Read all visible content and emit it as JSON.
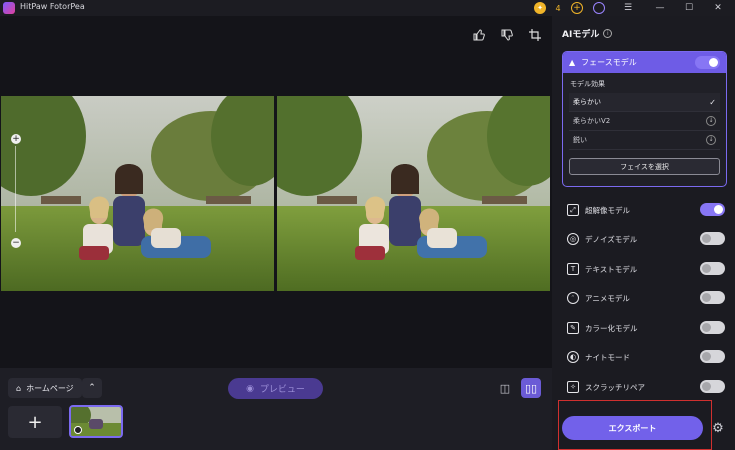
{
  "app": {
    "title": "HitPaw FotorPea",
    "coin_count": "4"
  },
  "titlebar": {
    "icons": [
      "coin-icon",
      "add-coin-icon",
      "account-icon",
      "menu-icon",
      "minimize-icon",
      "maximize-icon",
      "close-icon"
    ]
  },
  "workspace": {
    "toolbar": [
      "thumbs-up-icon",
      "thumbs-down-icon",
      "crop-icon"
    ]
  },
  "bottom": {
    "home_label": "ホームページ",
    "preview_label": "プレビュー",
    "add_label": "+"
  },
  "panel": {
    "title": "AIモデル",
    "face_model": {
      "label": "フェースモデル",
      "enabled": true,
      "effect_title": "モデル効果",
      "effects": [
        {
          "label": "柔らかい",
          "selected": true
        },
        {
          "label": "柔らかいV2",
          "selected": false
        },
        {
          "label": "鋭い",
          "selected": false
        }
      ],
      "select_face_label": "フェイスを選択"
    },
    "models": [
      {
        "label": "超解像モデル",
        "icon": "upscale-icon",
        "enabled": true
      },
      {
        "label": "デノイズモデル",
        "icon": "denoise-icon",
        "enabled": false
      },
      {
        "label": "テキストモデル",
        "icon": "text-icon",
        "enabled": false
      },
      {
        "label": "アニメモデル",
        "icon": "anime-icon",
        "enabled": false
      },
      {
        "label": "カラー化モデル",
        "icon": "colorize-icon",
        "enabled": false
      },
      {
        "label": "ナイトモード",
        "icon": "night-icon",
        "enabled": false
      },
      {
        "label": "スクラッチリペア",
        "icon": "scratch-icon",
        "enabled": false
      }
    ],
    "export_label": "エクスポート"
  },
  "colors": {
    "accent": "#7261ea",
    "panel_bg": "#1b1b21",
    "workspace_bg": "#141419",
    "coin": "#f0b429"
  }
}
